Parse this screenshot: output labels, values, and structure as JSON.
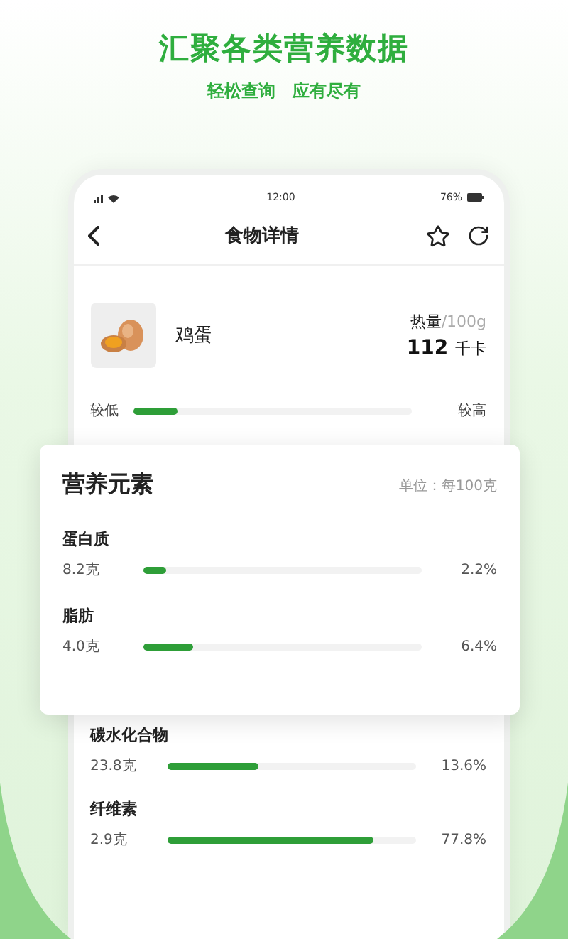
{
  "header": {
    "title": "汇聚各类营养数据",
    "subtitle": "轻松查询　应有尽有"
  },
  "status_bar": {
    "time": "12:00",
    "battery": "76%"
  },
  "nav": {
    "title": "食物详情"
  },
  "food": {
    "name": "鸡蛋",
    "energy_label": "热量",
    "energy_per": "/100g",
    "energy_value": "112",
    "energy_unit": "千卡"
  },
  "energy_meter": {
    "low": "较低",
    "high": "较高",
    "level": 0.16
  },
  "nutrients_card": {
    "title": "营养元素",
    "unit": "单位：每100克",
    "items": [
      {
        "name": "蛋白质",
        "amount": "8.2克",
        "percent": "2.2%",
        "level": 0.08
      },
      {
        "name": "脂肪",
        "amount": "4.0克",
        "percent": "6.4%",
        "level": 0.18
      }
    ]
  },
  "nutrients": [
    {
      "name": "碳水化合物",
      "amount": "23.8克",
      "percent": "13.6%",
      "level": 0.37
    },
    {
      "name": "纤维素",
      "amount": "2.9克",
      "percent": "77.8%",
      "level": 0.83
    }
  ]
}
